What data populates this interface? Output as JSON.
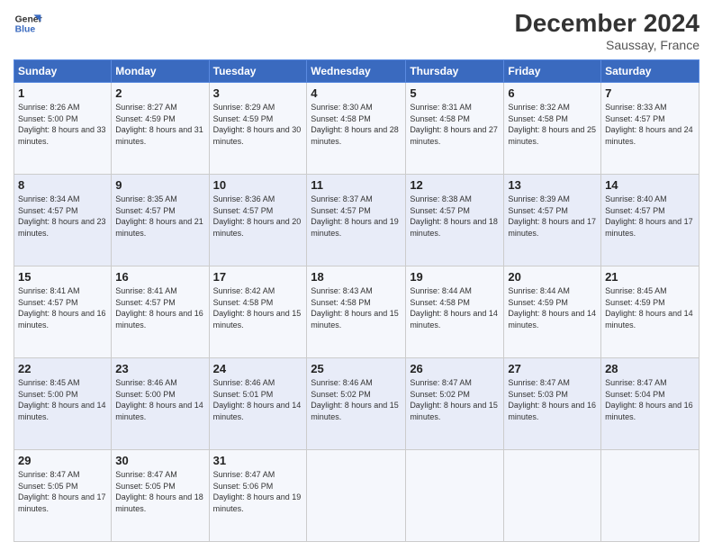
{
  "header": {
    "logo_line1": "General",
    "logo_line2": "Blue",
    "month": "December 2024",
    "location": "Saussay, France"
  },
  "weekdays": [
    "Sunday",
    "Monday",
    "Tuesday",
    "Wednesday",
    "Thursday",
    "Friday",
    "Saturday"
  ],
  "weeks": [
    [
      {
        "day": "1",
        "sunrise": "8:26 AM",
        "sunset": "5:00 PM",
        "daylight": "8 hours and 33 minutes."
      },
      {
        "day": "2",
        "sunrise": "8:27 AM",
        "sunset": "4:59 PM",
        "daylight": "8 hours and 31 minutes."
      },
      {
        "day": "3",
        "sunrise": "8:29 AM",
        "sunset": "4:59 PM",
        "daylight": "8 hours and 30 minutes."
      },
      {
        "day": "4",
        "sunrise": "8:30 AM",
        "sunset": "4:58 PM",
        "daylight": "8 hours and 28 minutes."
      },
      {
        "day": "5",
        "sunrise": "8:31 AM",
        "sunset": "4:58 PM",
        "daylight": "8 hours and 27 minutes."
      },
      {
        "day": "6",
        "sunrise": "8:32 AM",
        "sunset": "4:58 PM",
        "daylight": "8 hours and 25 minutes."
      },
      {
        "day": "7",
        "sunrise": "8:33 AM",
        "sunset": "4:57 PM",
        "daylight": "8 hours and 24 minutes."
      }
    ],
    [
      {
        "day": "8",
        "sunrise": "8:34 AM",
        "sunset": "4:57 PM",
        "daylight": "8 hours and 23 minutes."
      },
      {
        "day": "9",
        "sunrise": "8:35 AM",
        "sunset": "4:57 PM",
        "daylight": "8 hours and 21 minutes."
      },
      {
        "day": "10",
        "sunrise": "8:36 AM",
        "sunset": "4:57 PM",
        "daylight": "8 hours and 20 minutes."
      },
      {
        "day": "11",
        "sunrise": "8:37 AM",
        "sunset": "4:57 PM",
        "daylight": "8 hours and 19 minutes."
      },
      {
        "day": "12",
        "sunrise": "8:38 AM",
        "sunset": "4:57 PM",
        "daylight": "8 hours and 18 minutes."
      },
      {
        "day": "13",
        "sunrise": "8:39 AM",
        "sunset": "4:57 PM",
        "daylight": "8 hours and 17 minutes."
      },
      {
        "day": "14",
        "sunrise": "8:40 AM",
        "sunset": "4:57 PM",
        "daylight": "8 hours and 17 minutes."
      }
    ],
    [
      {
        "day": "15",
        "sunrise": "8:41 AM",
        "sunset": "4:57 PM",
        "daylight": "8 hours and 16 minutes."
      },
      {
        "day": "16",
        "sunrise": "8:41 AM",
        "sunset": "4:57 PM",
        "daylight": "8 hours and 16 minutes."
      },
      {
        "day": "17",
        "sunrise": "8:42 AM",
        "sunset": "4:58 PM",
        "daylight": "8 hours and 15 minutes."
      },
      {
        "day": "18",
        "sunrise": "8:43 AM",
        "sunset": "4:58 PM",
        "daylight": "8 hours and 15 minutes."
      },
      {
        "day": "19",
        "sunrise": "8:44 AM",
        "sunset": "4:58 PM",
        "daylight": "8 hours and 14 minutes."
      },
      {
        "day": "20",
        "sunrise": "8:44 AM",
        "sunset": "4:59 PM",
        "daylight": "8 hours and 14 minutes."
      },
      {
        "day": "21",
        "sunrise": "8:45 AM",
        "sunset": "4:59 PM",
        "daylight": "8 hours and 14 minutes."
      }
    ],
    [
      {
        "day": "22",
        "sunrise": "8:45 AM",
        "sunset": "5:00 PM",
        "daylight": "8 hours and 14 minutes."
      },
      {
        "day": "23",
        "sunrise": "8:46 AM",
        "sunset": "5:00 PM",
        "daylight": "8 hours and 14 minutes."
      },
      {
        "day": "24",
        "sunrise": "8:46 AM",
        "sunset": "5:01 PM",
        "daylight": "8 hours and 14 minutes."
      },
      {
        "day": "25",
        "sunrise": "8:46 AM",
        "sunset": "5:02 PM",
        "daylight": "8 hours and 15 minutes."
      },
      {
        "day": "26",
        "sunrise": "8:47 AM",
        "sunset": "5:02 PM",
        "daylight": "8 hours and 15 minutes."
      },
      {
        "day": "27",
        "sunrise": "8:47 AM",
        "sunset": "5:03 PM",
        "daylight": "8 hours and 16 minutes."
      },
      {
        "day": "28",
        "sunrise": "8:47 AM",
        "sunset": "5:04 PM",
        "daylight": "8 hours and 16 minutes."
      }
    ],
    [
      {
        "day": "29",
        "sunrise": "8:47 AM",
        "sunset": "5:05 PM",
        "daylight": "8 hours and 17 minutes."
      },
      {
        "day": "30",
        "sunrise": "8:47 AM",
        "sunset": "5:05 PM",
        "daylight": "8 hours and 18 minutes."
      },
      {
        "day": "31",
        "sunrise": "8:47 AM",
        "sunset": "5:06 PM",
        "daylight": "8 hours and 19 minutes."
      },
      null,
      null,
      null,
      null
    ]
  ]
}
